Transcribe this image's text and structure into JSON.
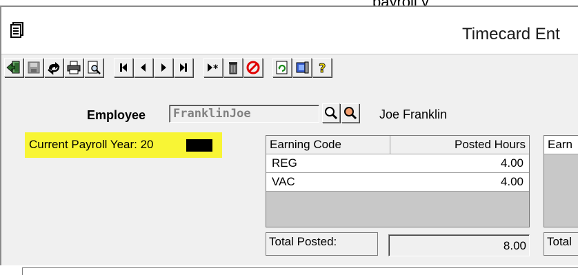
{
  "clipped_top_text": "payroll y",
  "window": {
    "title": "Timecard Ent"
  },
  "toolbar": {
    "buttons": [
      {
        "name": "exit-icon"
      },
      {
        "name": "save-icon"
      },
      {
        "name": "undo-icon"
      },
      {
        "name": "print-icon"
      },
      {
        "name": "preview-icon"
      },
      {
        "name": "first-record-icon"
      },
      {
        "name": "previous-record-icon"
      },
      {
        "name": "next-record-icon"
      },
      {
        "name": "last-record-icon"
      },
      {
        "name": "new-record-icon"
      },
      {
        "name": "delete-icon"
      },
      {
        "name": "cancel-icon"
      },
      {
        "name": "refresh-icon"
      },
      {
        "name": "tools-icon"
      },
      {
        "name": "help-icon"
      }
    ]
  },
  "employee": {
    "label": "Employee",
    "id": "FranklinJoe",
    "name": "Joe Franklin"
  },
  "payroll_year": {
    "text": "Current Payroll Year:  20"
  },
  "grid": {
    "headers": [
      "Earning Code",
      "Posted Hours"
    ],
    "rows": [
      {
        "code": "REG",
        "hours": "4.00"
      },
      {
        "code": "VAC",
        "hours": "4.00"
      }
    ],
    "total_label": "Total Posted:",
    "total_value": "8.00"
  },
  "grid2": {
    "header": "Earn",
    "total_label": "Total"
  }
}
